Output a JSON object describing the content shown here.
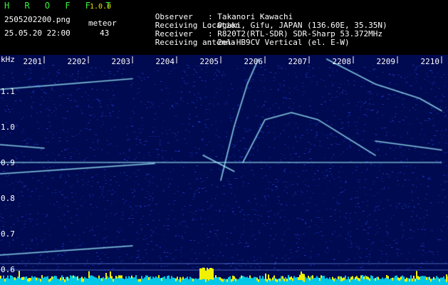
{
  "app": {
    "title": "H R O F F T",
    "version": "1.0.0",
    "filename": "2505202200.png",
    "datetime": "25.05.20 22:00",
    "meteor_label": "meteor",
    "meteor_count": "43"
  },
  "info": [
    {
      "label": "Observer",
      "value": ": Takanori Kawachi"
    },
    {
      "label": "Receiving Location",
      "value": ": Ogaki, Gifu, JAPAN (136.60E, 35.35N)"
    },
    {
      "label": "Receiver",
      "value": ": R820T2(RTL-SDR) SDR-Sharp 53.372MHz"
    },
    {
      "label": "Receiving antenna",
      "value": ": 2el-HB9CV Vertical (el. E-W)"
    }
  ],
  "colors": {
    "background": "#000a50",
    "noise": "#1e3cd2",
    "signal": "#a0f0ff",
    "bottom_bar": "#00c8e6",
    "peak": "#f0f000"
  },
  "chart_data": {
    "type": "heatmap",
    "ylabel": "kHz",
    "x_ticks": [
      "2201",
      "2202",
      "2203",
      "2204",
      "2205",
      "2206",
      "2207",
      "2208",
      "2209",
      "2210"
    ],
    "y_ticks": [
      "1.1",
      "1.0",
      "0.9",
      "0.8",
      "0.7",
      "0.6"
    ],
    "ylim": [
      0.6,
      1.15
    ],
    "traces": [
      {
        "points": [
          [
            2200.0,
            1.105
          ],
          [
            2203.0,
            1.135
          ]
        ]
      },
      {
        "points": [
          [
            2200.0,
            0.95
          ],
          [
            2201.0,
            0.94
          ]
        ]
      },
      {
        "points": [
          [
            2200.0,
            0.868
          ],
          [
            2203.5,
            0.897
          ]
        ]
      },
      {
        "points": [
          [
            2200.0,
            0.64
          ],
          [
            2203.0,
            0.666
          ]
        ]
      },
      {
        "points": [
          [
            2204.6,
            0.92
          ],
          [
            2205.3,
            0.875
          ]
        ]
      },
      {
        "points": [
          [
            2205.0,
            0.85
          ],
          [
            2205.3,
            1.0
          ],
          [
            2205.6,
            1.12
          ],
          [
            2205.85,
            1.19
          ]
        ]
      },
      {
        "points": [
          [
            2205.5,
            0.9
          ],
          [
            2206.0,
            1.02
          ],
          [
            2206.6,
            1.04
          ],
          [
            2207.2,
            1.02
          ],
          [
            2208.5,
            0.92
          ]
        ]
      },
      {
        "points": [
          [
            2207.4,
            1.19
          ],
          [
            2208.5,
            1.12
          ],
          [
            2209.5,
            1.08
          ],
          [
            2210.0,
            1.045
          ]
        ]
      },
      {
        "points": [
          [
            2208.5,
            0.96
          ],
          [
            2210.0,
            0.935
          ]
        ]
      },
      {
        "points": [
          [
            2200.0,
            0.9
          ],
          [
            2210.0,
            0.9
          ]
        ]
      }
    ]
  }
}
